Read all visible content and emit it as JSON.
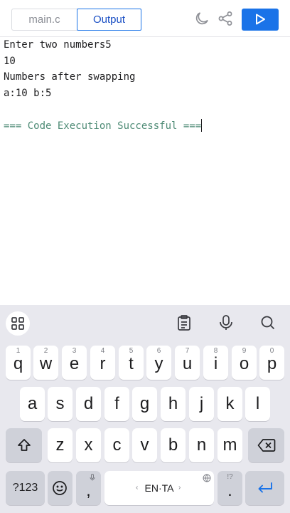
{
  "header": {
    "tabs": [
      {
        "label": "main.c",
        "active": false
      },
      {
        "label": "Output",
        "active": true
      }
    ],
    "icons": [
      "moon-icon",
      "share-icon",
      "play-icon"
    ],
    "accent_color": "#1a73e8"
  },
  "console": {
    "lines": [
      "Enter two numbers5",
      "10",
      "Numbers after swapping",
      "a:10 b:5"
    ],
    "success_message": "=== Code Execution Successful ===",
    "success_color": "#4c8a74"
  },
  "keyboard": {
    "toolbar_icons": [
      "grid-icon",
      "clipboard-icon",
      "microphone-icon",
      "search-icon"
    ],
    "row1": [
      {
        "key": "q",
        "hint": "1"
      },
      {
        "key": "w",
        "hint": "2"
      },
      {
        "key": "e",
        "hint": "3"
      },
      {
        "key": "r",
        "hint": "4"
      },
      {
        "key": "t",
        "hint": "5"
      },
      {
        "key": "y",
        "hint": "6"
      },
      {
        "key": "u",
        "hint": "7"
      },
      {
        "key": "i",
        "hint": "8"
      },
      {
        "key": "o",
        "hint": "9"
      },
      {
        "key": "p",
        "hint": "0"
      }
    ],
    "row2": [
      "a",
      "s",
      "d",
      "f",
      "g",
      "h",
      "j",
      "k",
      "l"
    ],
    "row3": [
      "z",
      "x",
      "c",
      "v",
      "b",
      "n",
      "m"
    ],
    "row4": {
      "symbols": "?123",
      "comma": ",",
      "space": "EN·TA",
      "space_left_arrow": "‹",
      "space_right_arrow": "›",
      "period": ".",
      "period_hint": "!?"
    }
  }
}
